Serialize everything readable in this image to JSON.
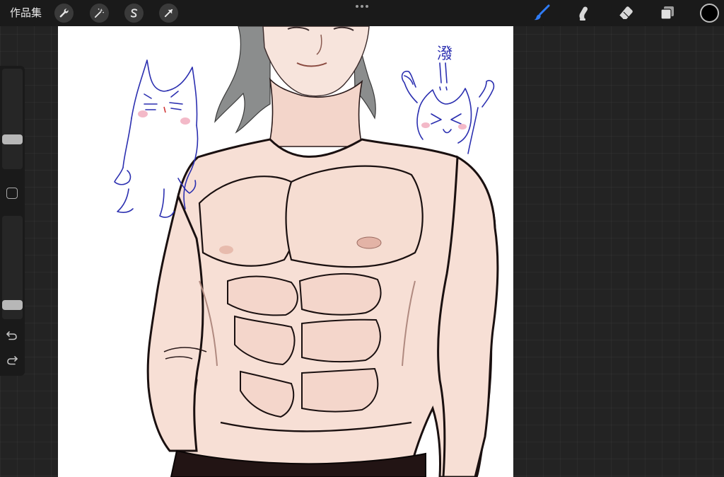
{
  "toolbar": {
    "gallery_label": "作品集",
    "actions_icon": "wrench-icon",
    "adjustments_icon": "magic-wand-icon",
    "selection_icon": "selection-s-icon",
    "transform_icon": "arrow-cursor-icon",
    "more_icon": "ellipsis-icon",
    "brush_icon": "brush-icon",
    "smudge_icon": "smudge-icon",
    "eraser_icon": "eraser-icon",
    "layers_icon": "layers-icon",
    "active_tool": "brush",
    "current_color": "#000000",
    "accent_color": "#2f7cf6"
  },
  "sidebar": {
    "brush_size_level": 0.27,
    "opacity_level": 0.1,
    "undo_icon": "undo-icon",
    "redo_icon": "redo-icon",
    "modify_icon": "square-icon"
  },
  "canvas": {
    "doodle_text": "潑",
    "doodle_marks": "!!",
    "ink_color": "#2b2fb0",
    "skin_color": "#f7dfd5",
    "line_color": "#1a1010"
  }
}
